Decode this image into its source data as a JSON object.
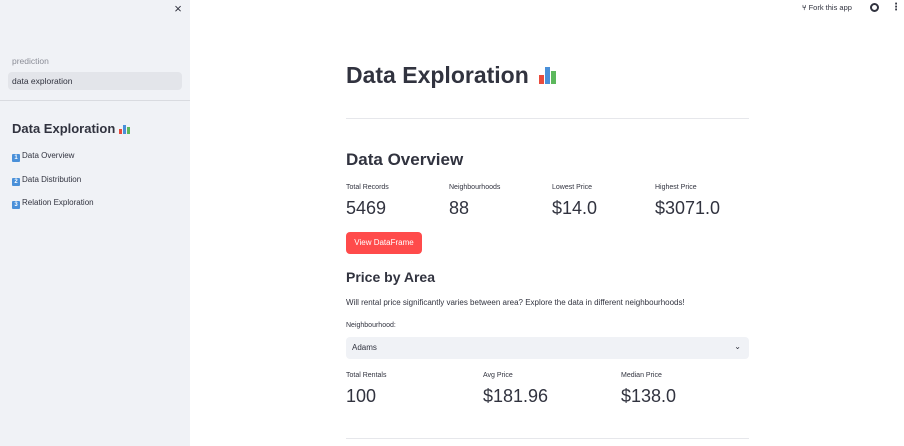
{
  "sidebar": {
    "close_symbol": "×",
    "nav": [
      {
        "label": "prediction",
        "active": false
      },
      {
        "label": "data exploration",
        "active": true
      }
    ],
    "section_title": "Data Exploration",
    "toc": [
      {
        "number": "1",
        "label": "Data Overview"
      },
      {
        "number": "2",
        "label": "Data Distribution"
      },
      {
        "number": "3",
        "label": "Relation Exploration"
      }
    ]
  },
  "topbar": {
    "fork_label": "Fork this app",
    "github_icon": "github-icon",
    "menu_symbol": "⋮"
  },
  "main": {
    "title": "Data Exploration",
    "overview": {
      "heading": "Data Overview",
      "metrics": [
        {
          "label": "Total Records",
          "value": "5469"
        },
        {
          "label": "Neighbourhoods",
          "value": "88"
        },
        {
          "label": "Lowest Price",
          "value": "$14.0"
        },
        {
          "label": "Highest Price",
          "value": "$3071.0"
        }
      ],
      "button_label": "View DataFrame"
    },
    "price_by_area": {
      "heading": "Price by Area",
      "description": "Will rental price significantly varies between area? Explore the data in different neighbourhoods!",
      "select_label": "Neighbourhood:",
      "select_value": "Adams",
      "metrics": [
        {
          "label": "Total Rentals",
          "value": "100"
        },
        {
          "label": "Avg Price",
          "value": "$181.96"
        },
        {
          "label": "Median Price",
          "value": "$138.0"
        }
      ]
    }
  },
  "colors": {
    "primary_button": "#ff4b4b",
    "sidebar_bg": "#f0f2f6",
    "text": "#31333f"
  }
}
